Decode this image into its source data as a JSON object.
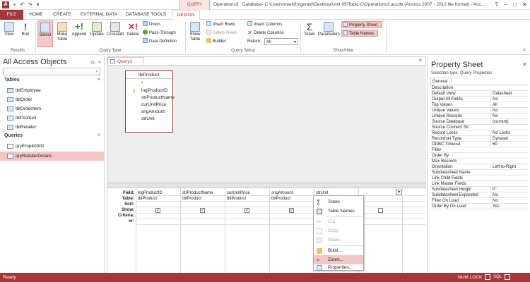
{
  "titlebar": {
    "context_group": "QUERY TOOLS",
    "window_title": "Operations3 : Database- C:\\Users\\markfitzgerald\\Desktop\\Unit 05\\Topic C\\Operations3.accdb (Access 2007 - 2013 file format) - Acc...",
    "controls": [
      "?",
      "–",
      "□",
      "✕"
    ]
  },
  "tabs": [
    "FILE",
    "HOME",
    "CREATE",
    "EXTERNAL DATA",
    "DATABASE TOOLS",
    "DESIGN"
  ],
  "ribbon": {
    "results": {
      "label": "Results",
      "view": "View",
      "run": "Run"
    },
    "query_type": {
      "label": "Query Type",
      "select": "Select",
      "make_table": "Make Table",
      "append": "Append",
      "update": "Update",
      "crosstab": "Crosstab",
      "delete": "Delete",
      "union": "Union",
      "pass_through": "Pass-Through",
      "data_definition": "Data Definition"
    },
    "query_setup": {
      "label": "Query Setup",
      "show_table": "Show Table",
      "insert_rows": "Insert Rows",
      "delete_rows": "Delete Rows",
      "builder": "Builder",
      "insert_columns": "Insert Columns",
      "delete_columns": "Delete Columns",
      "return_label": "Return:",
      "return_value": "All"
    },
    "show_hide": {
      "label": "Show/Hide",
      "totals": "Totals",
      "parameters": "Parameters",
      "property_sheet": "Property Sheet",
      "table_names": "Table Names"
    }
  },
  "nav": {
    "title": "All Access Objects",
    "tables_header": "Tables",
    "tables": [
      "tblEmployee",
      "tblOrder",
      "tblOrderItem",
      "tblProduct",
      "tblRetailer"
    ],
    "queries_header": "Queries",
    "queries": [
      "qryEmp40000",
      "qryRetailerDetails"
    ]
  },
  "document": {
    "tab": "Query1",
    "table_box": {
      "title": "tblProduct",
      "fields": [
        "*",
        "lngProductID",
        "strProductName",
        "curUnitPrice",
        "sngAmount",
        "strUnit"
      ]
    },
    "grid": {
      "row_labels": [
        "Field:",
        "Table:",
        "Sort:",
        "Show:",
        "Criteria:",
        "or:"
      ],
      "columns": [
        {
          "field": "lngProductID",
          "table": "tblProduct",
          "show": true
        },
        {
          "field": "strProductName",
          "table": "tblProduct",
          "show": true
        },
        {
          "field": "curUnitPrice",
          "table": "tblProduct",
          "show": true
        },
        {
          "field": "sngAmount",
          "table": "tblProduct",
          "show": true
        },
        {
          "field": "strUnit",
          "table": "tblProduct",
          "show": true
        },
        {
          "field": "",
          "table": "",
          "show": false
        }
      ]
    }
  },
  "context_menu": {
    "items": [
      {
        "label": "Totals",
        "disabled": false
      },
      {
        "label": "Table Names",
        "disabled": false
      },
      {
        "label": "Cut",
        "disabled": true
      },
      {
        "label": "Copy",
        "disabled": true
      },
      {
        "label": "Paste",
        "disabled": true
      },
      {
        "label": "Build...",
        "disabled": false
      },
      {
        "label": "Zoom...",
        "disabled": false
      },
      {
        "label": "Properties...",
        "disabled": false
      }
    ]
  },
  "property_sheet": {
    "title": "Property Sheet",
    "selection_type": "Selection type: Query Properties",
    "tab": "General",
    "rows": [
      {
        "k": "Description",
        "v": ""
      },
      {
        "k": "Default View",
        "v": "Datasheet"
      },
      {
        "k": "Output All Fields",
        "v": "No"
      },
      {
        "k": "Top Values",
        "v": "All"
      },
      {
        "k": "Unique Values",
        "v": "No"
      },
      {
        "k": "Unique Records",
        "v": "No"
      },
      {
        "k": "Source Database",
        "v": "(current)"
      },
      {
        "k": "Source Connect Str",
        "v": ""
      },
      {
        "k": "Record Locks",
        "v": "No Locks"
      },
      {
        "k": "Recordset Type",
        "v": "Dynaset"
      },
      {
        "k": "ODBC Timeout",
        "v": "60"
      },
      {
        "k": "Filter",
        "v": ""
      },
      {
        "k": "Order By",
        "v": ""
      },
      {
        "k": "Max Records",
        "v": ""
      },
      {
        "k": "Orientation",
        "v": "Left-to-Right"
      },
      {
        "k": "Subdatasheet Name",
        "v": ""
      },
      {
        "k": "Link Child Fields",
        "v": ""
      },
      {
        "k": "Link Master Fields",
        "v": ""
      },
      {
        "k": "Subdatasheet Height",
        "v": "0\""
      },
      {
        "k": "Subdatasheet Expanded",
        "v": "No"
      },
      {
        "k": "Filter On Load",
        "v": "No"
      },
      {
        "k": "Order By On Load",
        "v": "Yes"
      }
    ]
  },
  "status": {
    "left": "Ready",
    "numlock": "NUM LOCK",
    "sql": "SQL"
  },
  "colors": {
    "accent": "#a4373a",
    "highlight": "#f4c6c6"
  }
}
